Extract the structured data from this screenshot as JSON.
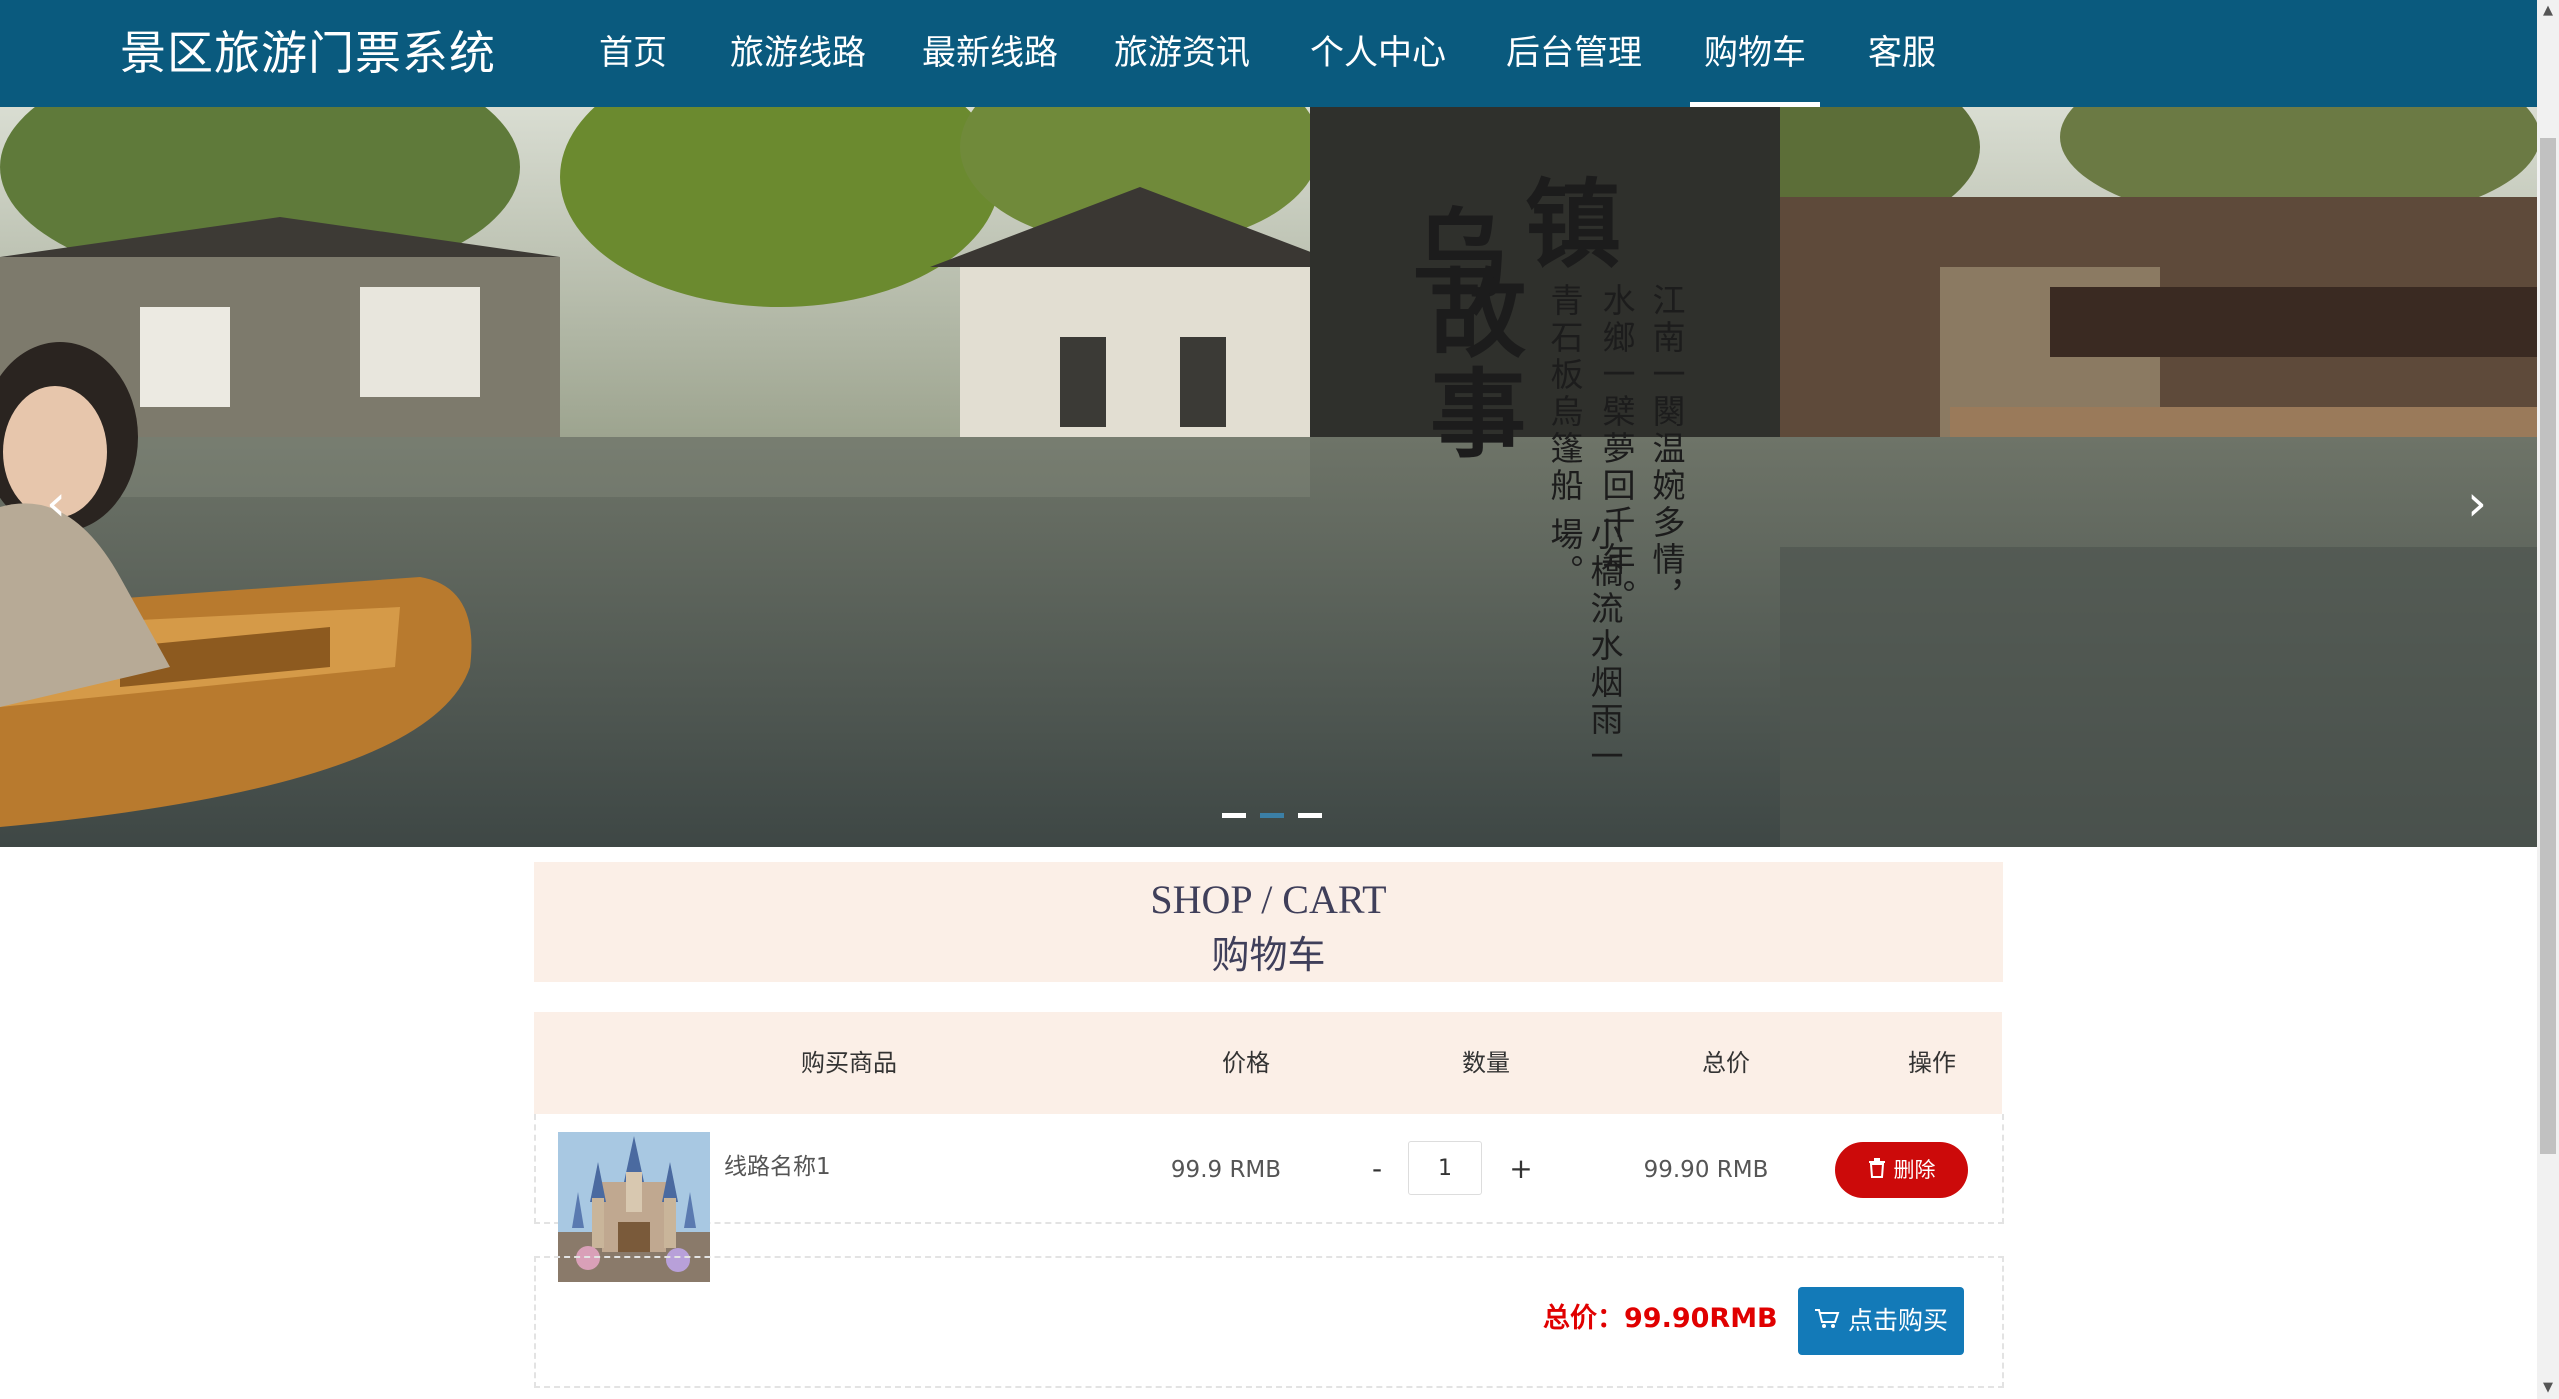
{
  "brand": "景区旅游门票系统",
  "nav": [
    {
      "label": "首页"
    },
    {
      "label": "旅游线路"
    },
    {
      "label": "最新线路"
    },
    {
      "label": "旅游资讯"
    },
    {
      "label": "个人中心"
    },
    {
      "label": "后台管理"
    },
    {
      "label": "购物车",
      "active": true
    },
    {
      "label": "客服"
    }
  ],
  "banner": {
    "title_chars": [
      "乌",
      "镇",
      "故",
      "事"
    ],
    "poem_lines": [
      "江南一闋温婉多情，",
      "水鄉一檗夢回千年。",
      "青石板烏篷船",
      "小橋流水烟雨一場。"
    ],
    "slide_count": 3,
    "active_slide": 2
  },
  "cart_header": {
    "english": "SHOP / CART",
    "chinese": "购物车"
  },
  "table": {
    "headers": [
      "购买商品",
      "价格",
      "数量",
      "总价",
      "操作"
    ],
    "rows": [
      {
        "name": "线路名称1",
        "price": "99.9 RMB",
        "quantity": "1",
        "subtotal": "99.90 RMB",
        "delete_label": "删除"
      }
    ]
  },
  "qty_minus": "-",
  "qty_plus": "+",
  "summary": {
    "total": "总价：99.90RMB",
    "buy_label": "点击购买"
  },
  "colors": {
    "nav_bg": "#0a5a7e",
    "header_bg": "#fbefe7",
    "delete": "#cc0a0a",
    "buy": "#137ab8",
    "total": "#e00000"
  }
}
